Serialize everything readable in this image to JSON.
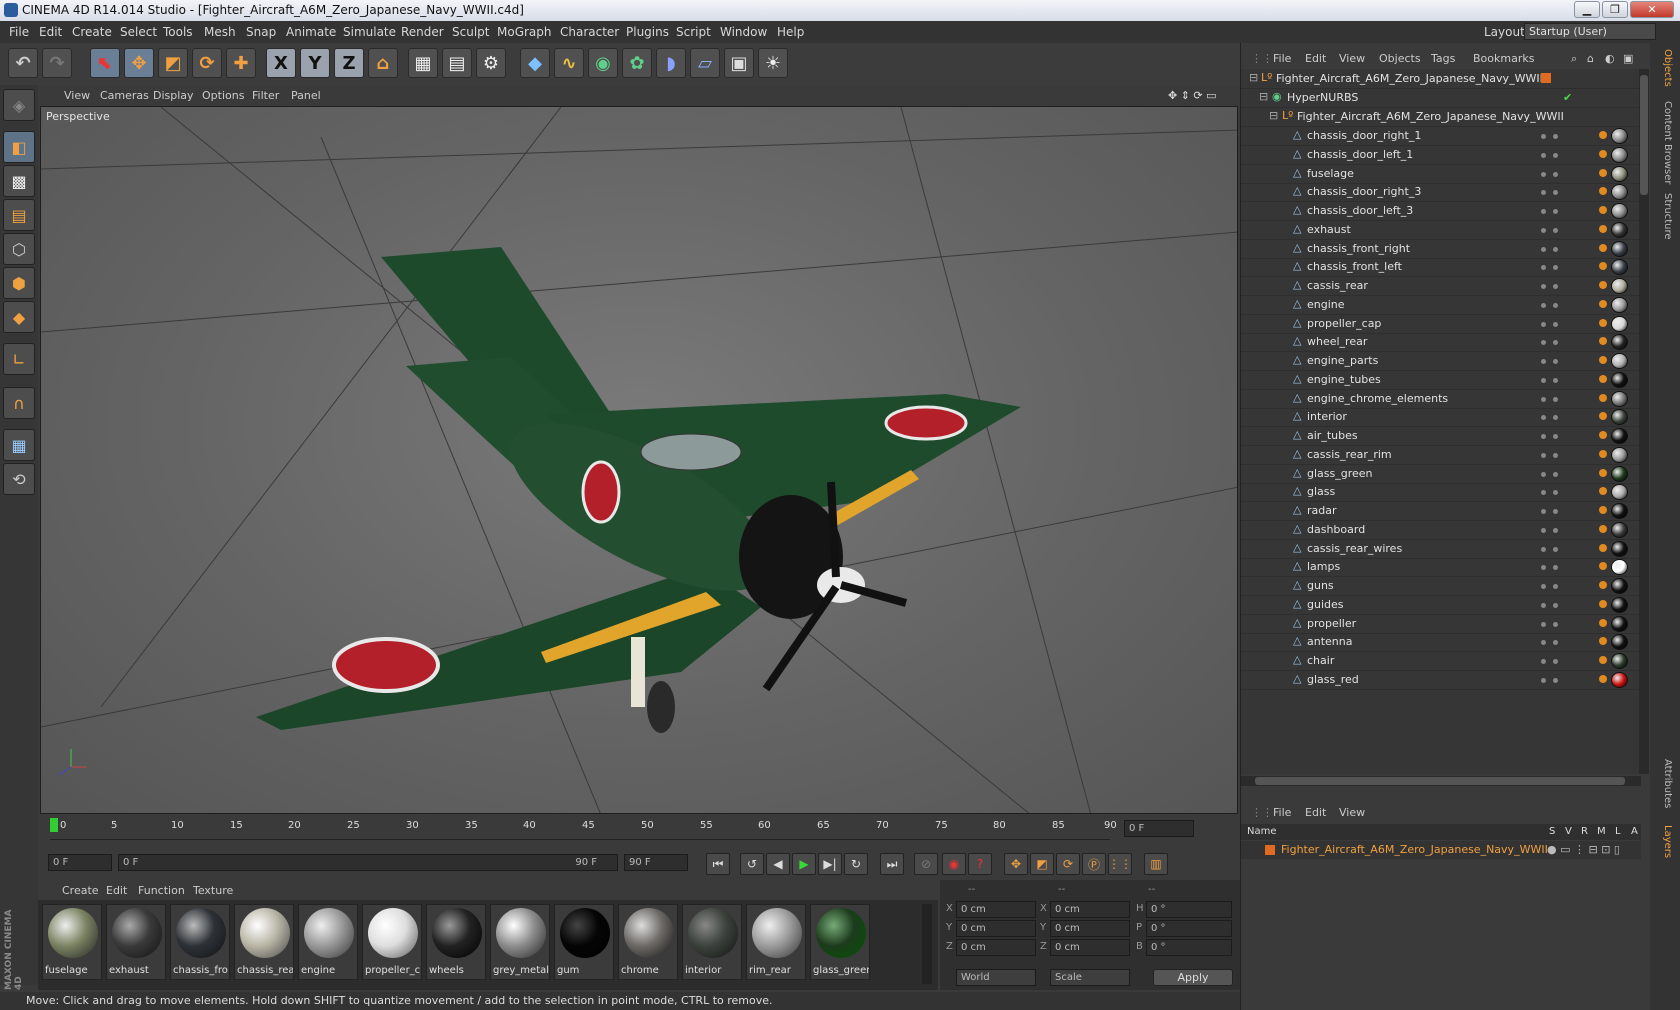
{
  "window": {
    "title": "CINEMA 4D R14.014 Studio - [Fighter_Aircraft_A6M_Zero_Japanese_Navy_WWII.c4d]",
    "min": "▁",
    "max": "❐",
    "close": "✕"
  },
  "menubar": {
    "items": [
      "File",
      "Edit",
      "Create",
      "Select",
      "Tools",
      "Mesh",
      "Snap",
      "Animate",
      "Simulate",
      "Render",
      "Sculpt",
      "MoGraph",
      "Character",
      "Plugins",
      "Script",
      "Window",
      "Help"
    ],
    "layout_label": "Layout:",
    "layout_value": "Startup (User)"
  },
  "toolbar": {
    "icons": [
      "undo-icon",
      "redo-icon",
      "live-selection-icon",
      "move-icon",
      "scale-icon",
      "rotate-icon",
      "add-icon",
      "x-axis-icon",
      "y-axis-icon",
      "z-axis-icon",
      "world-coords-icon",
      "render-view-icon",
      "render-picture-viewer-icon",
      "render-settings-icon",
      "cube-icon",
      "spline-icon",
      "nurbs-icon",
      "array-icon",
      "deformer-icon",
      "floor-icon",
      "camera-icon",
      "light-icon"
    ],
    "axis_labels": [
      "X",
      "Y",
      "Z"
    ]
  },
  "viewport": {
    "menu": [
      "View",
      "Cameras",
      "Display",
      "Options",
      "Filter",
      "Panel"
    ],
    "label": "Perspective"
  },
  "timeline": {
    "ticks": [
      "0",
      "5",
      "10",
      "15",
      "20",
      "25",
      "30",
      "35",
      "40",
      "45",
      "50",
      "55",
      "60",
      "65",
      "70",
      "75",
      "80",
      "85",
      "90"
    ],
    "end_frame": "0 F"
  },
  "playback": {
    "current_frame": "0 F",
    "range_start": "0 F",
    "range_end": "90 F",
    "max_frame": "90 F"
  },
  "materials": {
    "menu": [
      "Create",
      "Edit",
      "Function",
      "Texture"
    ],
    "items": [
      {
        "label": "fuselage",
        "color": "#7b8463"
      },
      {
        "label": "exhaust",
        "color": "#3a3a3a"
      },
      {
        "label": "chassis_fro",
        "color": "#2d3238"
      },
      {
        "label": "chassis_rea",
        "color": "#b9b5a6"
      },
      {
        "label": "engine",
        "color": "#9a9a9a"
      },
      {
        "label": "propeller_c",
        "color": "#dedede"
      },
      {
        "label": "wheels",
        "color": "#222222"
      },
      {
        "label": "grey_metal",
        "color": "#8e8e8e"
      },
      {
        "label": "gum",
        "color": "#050505"
      },
      {
        "label": "chrome",
        "color": "#6d6a66"
      },
      {
        "label": "interior",
        "color": "#3c423c"
      },
      {
        "label": "rim_rear",
        "color": "#9c9c9c"
      },
      {
        "label": "glass_green",
        "color": "#1d3b1d"
      }
    ],
    "brand": "MAXON CINEMA 4D"
  },
  "coords": {
    "headers": [
      "--",
      "--",
      "--"
    ],
    "rows": [
      {
        "a": "X",
        "av": "0 cm",
        "b": "X",
        "bv": "0 cm",
        "c": "H",
        "cv": "0 °"
      },
      {
        "a": "Y",
        "av": "0 cm",
        "b": "Y",
        "bv": "0 cm",
        "c": "P",
        "cv": "0 °"
      },
      {
        "a": "Z",
        "av": "0 cm",
        "b": "Z",
        "bv": "0 cm",
        "c": "B",
        "cv": "0 °"
      }
    ],
    "mode": "World",
    "scale": "Scale",
    "apply": "Apply"
  },
  "status": "Move: Click and drag to move elements. Hold down SHIFT to quantize movement / add to the selection in point mode, CTRL to remove.",
  "objects": {
    "menu": [
      "File",
      "Edit",
      "View",
      "Objects",
      "Tags",
      "Bookmarks"
    ],
    "root": "Fighter_Aircraft_A6M_Zero_Japanese_Navy_WWII",
    "hypernurbs": "HyperNURBS",
    "group": "Fighter_Aircraft_A6M_Zero_Japanese_Navy_WWII",
    "children": [
      {
        "name": "chassis_door_right_1",
        "tag": "#8a8a8a"
      },
      {
        "name": "chassis_door_left_1",
        "tag": "#8a8a8a"
      },
      {
        "name": "fuselage",
        "tag": "#8d8f7c"
      },
      {
        "name": "chassis_door_right_3",
        "tag": "#8a8a8a"
      },
      {
        "name": "chassis_door_left_3",
        "tag": "#8a8a8a"
      },
      {
        "name": "exhaust",
        "tag": "#333333"
      },
      {
        "name": "chassis_front_right",
        "tag": "#3a3f47"
      },
      {
        "name": "chassis_front_left",
        "tag": "#3a3f47"
      },
      {
        "name": "cassis_rear",
        "tag": "#b0ad9f"
      },
      {
        "name": "engine",
        "tag": "#9a9a9a"
      },
      {
        "name": "propeller_cap",
        "tag": "#d8d8d8"
      },
      {
        "name": "wheel_rear",
        "tag": "#222222"
      },
      {
        "name": "engine_parts",
        "tag": "#b0b0b0"
      },
      {
        "name": "engine_tubes",
        "tag": "#111111"
      },
      {
        "name": "engine_chrome_elements",
        "tag": "#777777"
      },
      {
        "name": "interior",
        "tag": "#3c423c"
      },
      {
        "name": "air_tubes",
        "tag": "#111111"
      },
      {
        "name": "cassis_rear_rim",
        "tag": "#999999"
      },
      {
        "name": "glass_green",
        "tag": "#1d3b1d"
      },
      {
        "name": "glass",
        "tag": "#a9a9a9"
      },
      {
        "name": "radar",
        "tag": "#111111"
      },
      {
        "name": "dashboard",
        "tag": "#3a3a3a"
      },
      {
        "name": "cassis_rear_wires",
        "tag": "#111111"
      },
      {
        "name": "lamps",
        "tag": "#ffffff"
      },
      {
        "name": "guns",
        "tag": "#111111"
      },
      {
        "name": "guides",
        "tag": "#111111"
      },
      {
        "name": "propeller",
        "tag": "#111111"
      },
      {
        "name": "antenna",
        "tag": "#111111"
      },
      {
        "name": "chair",
        "tag": "#2b3b2b"
      },
      {
        "name": "glass_red",
        "tag": "#cc1111"
      }
    ]
  },
  "layers": {
    "menu": [
      "File",
      "Edit",
      "View"
    ],
    "columns": [
      "Name",
      "S",
      "V",
      "R",
      "M",
      "L",
      "A"
    ],
    "row": "Fighter_Aircraft_A6M_Zero_Japanese_Navy_WWII"
  },
  "side_tabs": [
    "Objects",
    "Content Browser",
    "Structure",
    "Attributes",
    "Layers"
  ],
  "colors": {
    "accent": "#f0a040",
    "roundel": "#b3202a",
    "plane_green": "#1e4a2c",
    "wing_stripe": "#e0a52a"
  }
}
